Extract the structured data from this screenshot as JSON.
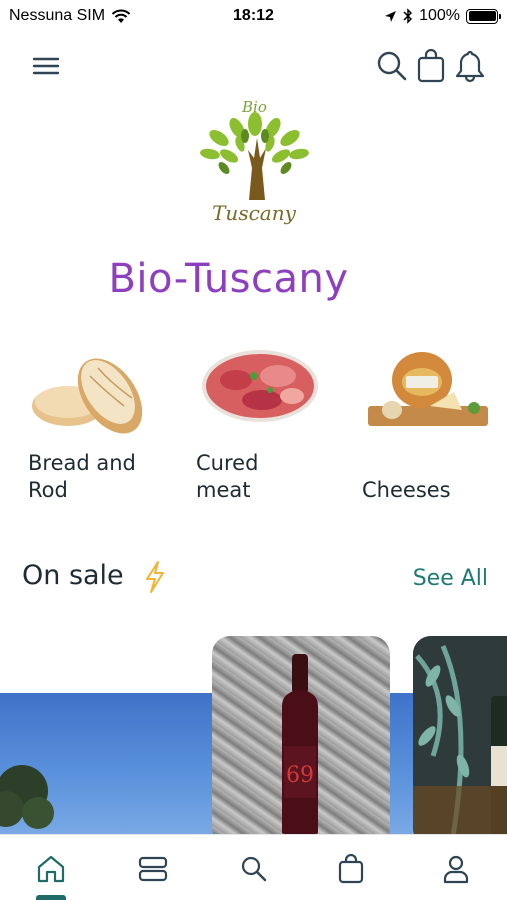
{
  "status_bar": {
    "carrier": "Nessuna SIM",
    "time": "18:12",
    "battery": "100%",
    "battery_level": 1.0
  },
  "header": {
    "menu_icon": "hamburger-menu-icon",
    "search_icon": "search-icon",
    "bag_icon": "shopping-bag-icon",
    "bell_icon": "bell-icon"
  },
  "logo": {
    "top_text": "Bio",
    "bottom_text": "Tuscany"
  },
  "brand": {
    "title": "Bio-Tuscany",
    "color": "#8e3fc0"
  },
  "categories": [
    {
      "label": "Bread and Rod",
      "icon": "bread-image"
    },
    {
      "label": "Cured meat",
      "icon": "cured-meat-image"
    },
    {
      "label": "Cheeses",
      "icon": "cheese-image"
    }
  ],
  "on_sale": {
    "title": "On sale",
    "see_all": "See All",
    "accent": "#1f7a73"
  },
  "tab_bar": {
    "active": "home",
    "accent": "#1f6b67",
    "items": [
      "home-icon",
      "list-icon",
      "search-icon",
      "bag-icon",
      "user-icon"
    ]
  }
}
